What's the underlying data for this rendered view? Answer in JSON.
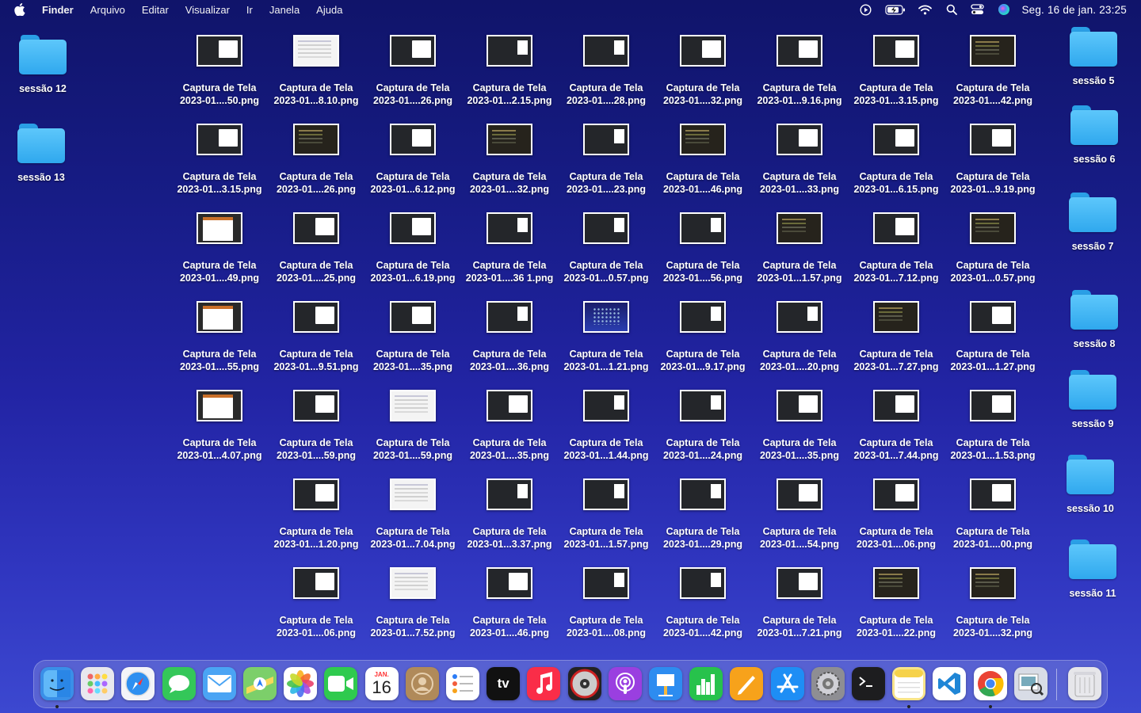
{
  "menubar": {
    "app": "Finder",
    "menus": [
      "Arquivo",
      "Editar",
      "Visualizar",
      "Ir",
      "Janela",
      "Ajuda"
    ],
    "clock": "Seg. 16 de jan.  23:25",
    "status_icons": [
      "play-circle-icon",
      "battery-charging-icon",
      "wifi-icon",
      "search-icon",
      "control-center-icon",
      "siri-icon"
    ]
  },
  "desktop_folders": {
    "left": [
      "sessão 12",
      "sessão 13"
    ],
    "right": [
      "sessão 5",
      "sessão 6",
      "sessão 7",
      "sessão 8",
      "sessão 9",
      "sessão 10",
      "sessão 11"
    ]
  },
  "file_name_prefix": "Captura de Tela",
  "files": {
    "rows": [
      [
        {
          "name": "2023-01....50.png",
          "thumb": "dark"
        },
        {
          "name": "2023-01...8.10.png",
          "thumb": "white"
        },
        {
          "name": "2023-01....26.png",
          "thumb": "dark"
        },
        {
          "name": "2023-01...2.15.png",
          "thumb": "small"
        },
        {
          "name": "2023-01....28.png",
          "thumb": "small"
        },
        {
          "name": "2023-01....32.png",
          "thumb": "dark"
        },
        {
          "name": "2023-01...9.16.png",
          "thumb": "dark"
        },
        {
          "name": "2023-01...3.15.png",
          "thumb": "dark"
        },
        {
          "name": "2023-01....42.png",
          "thumb": "term"
        }
      ],
      [
        {
          "name": "2023-01...3.15.png",
          "thumb": "dark"
        },
        {
          "name": "2023-01....26.png",
          "thumb": "term"
        },
        {
          "name": "2023-01...6.12.png",
          "thumb": "dark"
        },
        {
          "name": "2023-01....32.png",
          "thumb": "term"
        },
        {
          "name": "2023-01....23.png",
          "thumb": "small"
        },
        {
          "name": "2023-01....46.png",
          "thumb": "term"
        },
        {
          "name": "2023-01....33.png",
          "thumb": "dark"
        },
        {
          "name": "2023-01...6.15.png",
          "thumb": "dark"
        },
        {
          "name": "2023-01...9.19.png",
          "thumb": "dark"
        }
      ],
      [
        {
          "name": "2023-01....49.png",
          "thumb": "doc"
        },
        {
          "name": "2023-01....25.png",
          "thumb": "dark"
        },
        {
          "name": "2023-01...6.19.png",
          "thumb": "dark"
        },
        {
          "name": "2023-01....36 1.png",
          "thumb": "small"
        },
        {
          "name": "2023-01...0.57.png",
          "thumb": "small"
        },
        {
          "name": "2023-01....56.png",
          "thumb": "small"
        },
        {
          "name": "2023-01...1.57.png",
          "thumb": "term"
        },
        {
          "name": "2023-01...7.12.png",
          "thumb": "dark"
        },
        {
          "name": "2023-01...0.57.png",
          "thumb": "term"
        }
      ],
      [
        {
          "name": "2023-01....55.png",
          "thumb": "doc"
        },
        {
          "name": "2023-01...9.51.png",
          "thumb": "dark"
        },
        {
          "name": "2023-01....35.png",
          "thumb": "dark"
        },
        {
          "name": "2023-01....36.png",
          "thumb": "small"
        },
        {
          "name": "2023-01...1.21.png",
          "thumb": "desk"
        },
        {
          "name": "2023-01...9.17.png",
          "thumb": "small"
        },
        {
          "name": "2023-01....20.png",
          "thumb": "small"
        },
        {
          "name": "2023-01...7.27.png",
          "thumb": "term"
        },
        {
          "name": "2023-01...1.27.png",
          "thumb": "dark"
        }
      ],
      [
        {
          "name": "2023-01...4.07.png",
          "thumb": "doc"
        },
        {
          "name": "2023-01....59.png",
          "thumb": "dark"
        },
        {
          "name": "2023-01....59.png",
          "thumb": "white"
        },
        {
          "name": "2023-01....35.png",
          "thumb": "dark"
        },
        {
          "name": "2023-01...1.44.png",
          "thumb": "small"
        },
        {
          "name": "2023-01....24.png",
          "thumb": "small"
        },
        {
          "name": "2023-01....35.png",
          "thumb": "dark"
        },
        {
          "name": "2023-01...7.44.png",
          "thumb": "dark"
        },
        {
          "name": "2023-01...1.53.png",
          "thumb": "dark"
        }
      ],
      [
        null,
        {
          "name": "2023-01...1.20.png",
          "thumb": "dark"
        },
        {
          "name": "2023-01...7.04.png",
          "thumb": "white"
        },
        {
          "name": "2023-01...3.37.png",
          "thumb": "small"
        },
        {
          "name": "2023-01...1.57.png",
          "thumb": "small"
        },
        {
          "name": "2023-01....29.png",
          "thumb": "small"
        },
        {
          "name": "2023-01....54.png",
          "thumb": "dark"
        },
        {
          "name": "2023-01....06.png",
          "thumb": "dark"
        },
        {
          "name": "2023-01....00.png",
          "thumb": "dark"
        }
      ],
      [
        null,
        {
          "name": "2023-01....06.png",
          "thumb": "dark"
        },
        {
          "name": "2023-01...7.52.png",
          "thumb": "white"
        },
        {
          "name": "2023-01....46.png",
          "thumb": "dark"
        },
        {
          "name": "2023-01....08.png",
          "thumb": "small"
        },
        {
          "name": "2023-01....42.png",
          "thumb": "small"
        },
        {
          "name": "2023-01...7.21.png",
          "thumb": "dark"
        },
        {
          "name": "2023-01....22.png",
          "thumb": "term"
        },
        {
          "name": "2023-01....32.png",
          "thumb": "term"
        }
      ]
    ]
  },
  "dock": {
    "calendar_month": "JAN.",
    "calendar_day": "16",
    "tv_label": "tv",
    "apps": [
      {
        "name": "finder-icon",
        "color": "#3a8fe8",
        "running": true
      },
      {
        "name": "launchpad-icon",
        "color": "#e8e8ee",
        "running": false
      },
      {
        "name": "safari-icon",
        "color": "#f4f4f8",
        "running": false
      },
      {
        "name": "messages-icon",
        "color": "#34c759",
        "running": false
      },
      {
        "name": "mail-icon",
        "color": "#4aa4f4",
        "running": false
      },
      {
        "name": "maps-icon",
        "color": "#7ccf6a",
        "running": false
      },
      {
        "name": "photos-icon",
        "color": "#ffffff",
        "running": false
      },
      {
        "name": "facetime-icon",
        "color": "#2fca4e",
        "running": false
      },
      {
        "name": "calendar-icon",
        "color": "#ffffff",
        "running": false
      },
      {
        "name": "contacts-icon",
        "color": "#b08a5a",
        "running": false
      },
      {
        "name": "reminders-icon",
        "color": "#ffffff",
        "running": false
      },
      {
        "name": "apple-tv-icon",
        "color": "#111111",
        "running": false
      },
      {
        "name": "music-icon",
        "color": "#fa2d48",
        "running": false
      },
      {
        "name": "dvd-player-icon",
        "color": "#222222",
        "running": false
      },
      {
        "name": "podcasts-icon",
        "color": "#9a3fe0",
        "running": false
      },
      {
        "name": "keynote-icon",
        "color": "#2d8cf0",
        "running": false
      },
      {
        "name": "numbers-icon",
        "color": "#27c24c",
        "running": false
      },
      {
        "name": "pages-icon",
        "color": "#f7a21b",
        "running": false
      },
      {
        "name": "app-store-icon",
        "color": "#1e8ef5",
        "running": false
      },
      {
        "name": "system-settings-icon",
        "color": "#8e8e93",
        "running": false
      },
      {
        "name": "terminal-icon",
        "color": "#1d1d1f",
        "running": false
      },
      {
        "name": "notes-icon",
        "color": "#f8e48a",
        "running": true
      },
      {
        "name": "vscode-icon",
        "color": "#ffffff",
        "running": false
      },
      {
        "name": "chrome-icon",
        "color": "#ffffff",
        "running": true
      },
      {
        "name": "preview-icon",
        "color": "#d8dce6",
        "running": false
      },
      {
        "name": "trash-icon",
        "color": "#e6e6ea",
        "running": false
      }
    ]
  }
}
